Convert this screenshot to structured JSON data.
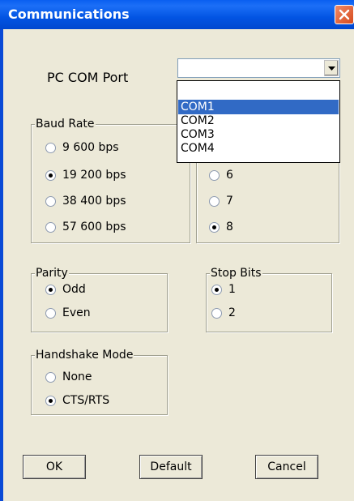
{
  "window": {
    "title": "Communications",
    "close_icon": "close-icon"
  },
  "com_port": {
    "label": "PC COM Port",
    "value": "",
    "options": [
      "COM1",
      "COM2",
      "COM3",
      "COM4"
    ],
    "highlighted": "COM1"
  },
  "baud_rate": {
    "title": "Baud Rate",
    "options": [
      "9 600 bps",
      "19 200 bps",
      "38 400 bps",
      "57 600 bps"
    ],
    "selected": "19 200 bps"
  },
  "data_bits": {
    "options": [
      "6",
      "7",
      "8"
    ],
    "selected": "8"
  },
  "parity": {
    "title": "Parity",
    "options": [
      "Odd",
      "Even"
    ],
    "selected": "Odd"
  },
  "stop_bits": {
    "title": "Stop Bits",
    "options": [
      "1",
      "2"
    ],
    "selected": "1"
  },
  "handshake": {
    "title": "Handshake Mode",
    "options": [
      "None",
      "CTS/RTS"
    ],
    "selected": "CTS/RTS"
  },
  "buttons": {
    "ok": "OK",
    "default": "Default",
    "cancel": "Cancel"
  },
  "colors": {
    "titlebar": "#0a5ff0",
    "dialog_bg": "#ece9d8",
    "selection": "#316ac5",
    "close_button": "#d64a1c"
  }
}
